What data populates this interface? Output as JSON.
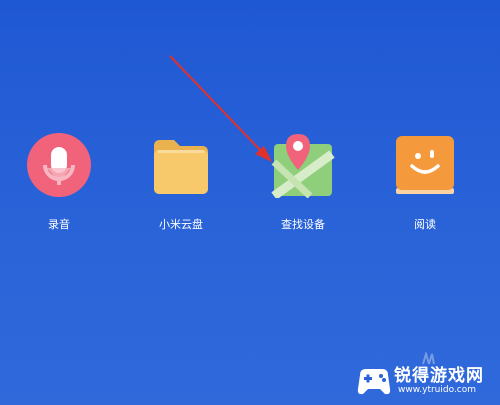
{
  "apps": [
    {
      "label": "录音",
      "icon": "microphone-icon"
    },
    {
      "label": "小米云盘",
      "icon": "folder-icon"
    },
    {
      "label": "查找设备",
      "icon": "map-pin-icon"
    },
    {
      "label": "阅读",
      "icon": "book-icon"
    }
  ],
  "annotation": {
    "arrow_color": "#e0312d",
    "pointing_to": "查找设备"
  },
  "watermark": {
    "name": "锐得游戏网",
    "url": "www.ytruido.com"
  },
  "colors": {
    "background": "#2a63d8",
    "recorder": "#f0637a",
    "folder": "#f7c96a",
    "map_green": "#8fcf7b",
    "map_pin": "#f0637a",
    "book": "#f59a3c"
  }
}
